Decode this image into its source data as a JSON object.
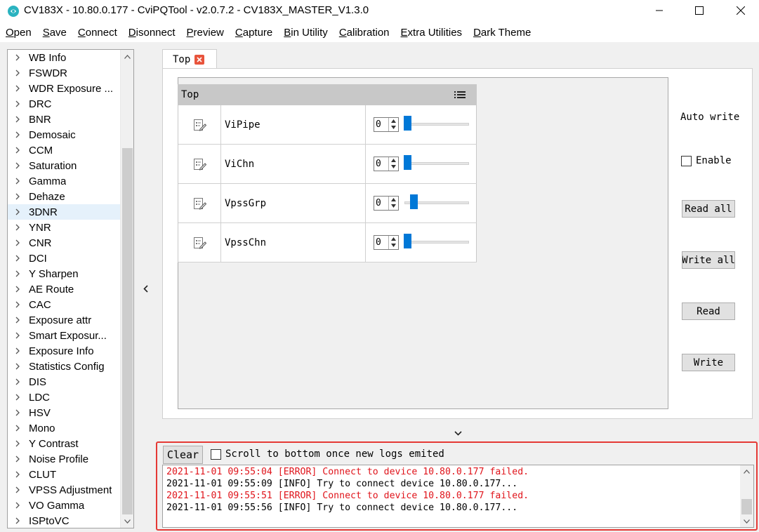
{
  "window": {
    "title": "CV183X - 10.80.0.177 - CviPQTool - v2.0.7.2 - CV183X_MASTER_V1.3.0",
    "controls": [
      "minimize-icon",
      "maximize-icon",
      "close-icon"
    ]
  },
  "menu": {
    "items": [
      {
        "underline": "O",
        "rest": "pen"
      },
      {
        "underline": "S",
        "rest": "ave"
      },
      {
        "underline": "C",
        "rest": "onnect"
      },
      {
        "underline": "D",
        "rest": "isonnect"
      },
      {
        "underline": "P",
        "rest": "review"
      },
      {
        "underline": "C",
        "rest": "apture"
      },
      {
        "underline": "B",
        "rest": "in Utility"
      },
      {
        "underline": "C",
        "rest": "alibration"
      },
      {
        "underline": "E",
        "rest": "xtra Utilities"
      },
      {
        "underline": "D",
        "rest": "ark Theme"
      }
    ]
  },
  "tree": {
    "selected_index": 10,
    "items": [
      "WB Info",
      "FSWDR",
      "WDR Exposure ...",
      "DRC",
      "BNR",
      "Demosaic",
      "CCM",
      "Saturation",
      "Gamma",
      "Dehaze",
      "3DNR",
      "YNR",
      "CNR",
      "DCI",
      "Y Sharpen",
      "AE Route",
      "CAC",
      "Exposure attr",
      "Smart Exposur...",
      "Exposure Info",
      "Statistics Config",
      "DIS",
      "LDC",
      "HSV",
      "Mono",
      "Y Contrast",
      "Noise Profile",
      "CLUT",
      "VPSS Adjustment",
      "VO Gamma",
      "ISPtoVC"
    ]
  },
  "tab": {
    "label": "Top"
  },
  "table": {
    "header": "Top",
    "rows": [
      {
        "name": "ViPipe",
        "value": "0"
      },
      {
        "name": "ViChn",
        "value": "0"
      },
      {
        "name": "VpssGrp",
        "value": "0"
      },
      {
        "name": "VpssChn",
        "value": "0"
      }
    ]
  },
  "side": {
    "auto_write_label": "Auto write",
    "enable_label": "Enable",
    "enable_checked": false,
    "read_all": "Read all",
    "write_all": "Write all",
    "read": "Read",
    "write": "Write"
  },
  "log": {
    "clear_label": "Clear",
    "scroll_option_label": "Scroll to bottom once new logs emited",
    "scroll_option_checked": false,
    "lines": [
      {
        "level": "error",
        "text": "2021-11-01 09:55:04 [ERROR] Connect to device 10.80.0.177 failed."
      },
      {
        "level": "info",
        "text": "2021-11-01 09:55:09 [INFO] Try to connect device 10.80.0.177..."
      },
      {
        "level": "error",
        "text": "2021-11-01 09:55:51 [ERROR] Connect to device 10.80.0.177 failed."
      },
      {
        "level": "info",
        "text": "2021-11-01 09:55:56 [INFO] Try to connect device 10.80.0.177..."
      }
    ],
    "error_color": "#e0141b"
  },
  "colors": {
    "accent": "#0078d7",
    "highlight_frame": "#e53935",
    "tab_close": "#e8543c"
  }
}
